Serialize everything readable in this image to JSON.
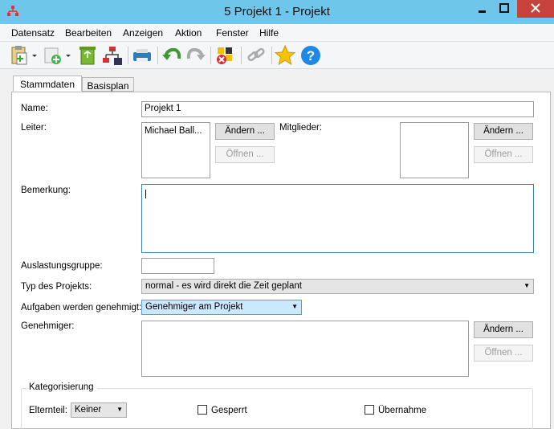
{
  "window": {
    "title": "5 Projekt 1  - Projekt"
  },
  "menu": {
    "items": [
      "Datensatz",
      "Bearbeiten",
      "Anzeigen",
      "Aktion",
      "Fenster",
      "Hilfe"
    ]
  },
  "toolbar": {
    "icons": [
      "paste-icon",
      "new-icon",
      "recycle-icon",
      "network-icon",
      "printer-icon",
      "undo-icon",
      "redo-icon",
      "tools-remove-icon",
      "link-icon",
      "star-icon",
      "help-icon"
    ]
  },
  "tabs": {
    "stammdaten": "Stammdaten",
    "basisplan": "Basisplan"
  },
  "form": {
    "name_label": "Name:",
    "name_value": "Projekt 1",
    "leiter_label": "Leiter:",
    "leiter_value": "Michael Ball...",
    "aendern_label": "Ändern ...",
    "oeffnen_label": "Öffnen ...",
    "mitglieder_label": "Mitglieder:",
    "bemerkung_label": "Bemerkung:",
    "auslastung_label": "Auslastungsgruppe:",
    "typ_label": "Typ des Projekts:",
    "typ_value": "normal - es wird direkt die Zeit geplant",
    "aufgaben_label": "Aufgaben werden genehmigt:",
    "aufgaben_value": "Genehmiger am Projekt",
    "genehmiger_label": "Genehmiger:"
  },
  "kategorisierung": {
    "title": "Kategorisierung",
    "elternteil_label": "Elternteil:",
    "elternteil_value": "Keiner",
    "gesperrt_label": "Gesperrt",
    "uebernahme_label": "Übernahme"
  },
  "colors": {
    "titlebar": "#6ec6ea",
    "close": "#c7423b",
    "selected_combo": "#cce8ff"
  }
}
